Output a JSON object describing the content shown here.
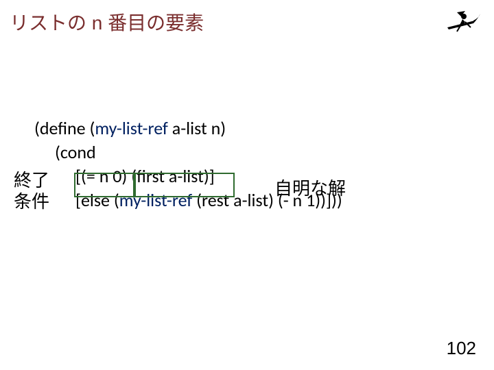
{
  "title": "リストの n 番目の要素",
  "logo": {
    "alt": "witch-silhouette-icon"
  },
  "code": {
    "l1_pre": "(define (",
    "l1_fn": "my-list-ref",
    "l1_post": " a-list n)",
    "l2": "(cond",
    "l3_a": "[",
    "l3_b": "(= n 0)",
    "l3_c": " ",
    "l3_d": "(first a-list)",
    "l3_e": "]",
    "l4_a": "[else (",
    "l4_fn": "my-list-ref",
    "l4_b": " (rest a-list) (- n 1))]))"
  },
  "annotations": {
    "left_l1": "終了",
    "left_l2": "条件",
    "right": "自明な解"
  },
  "page_number": "102"
}
